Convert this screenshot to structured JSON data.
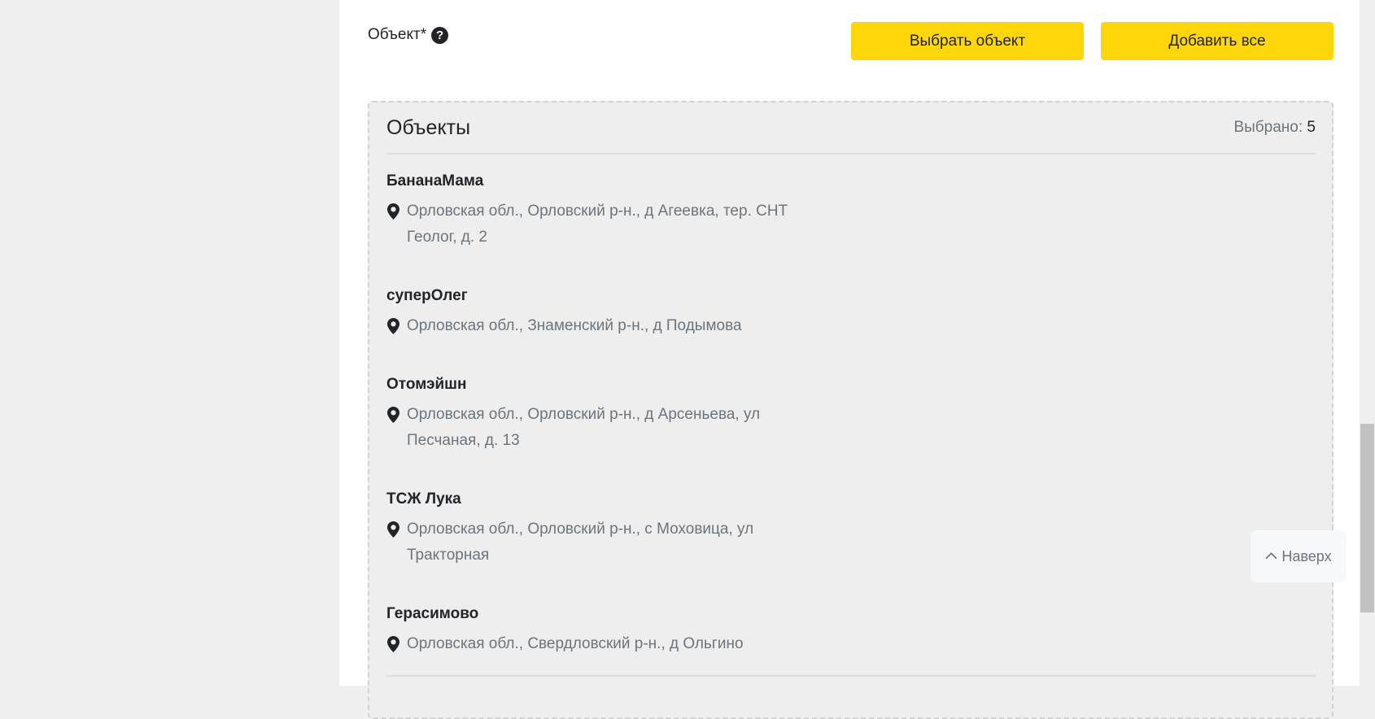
{
  "form": {
    "field_label": "Объект*",
    "help_icon_glyph": "?",
    "select_button": "Выбрать объект",
    "add_all_button": "Добавить все"
  },
  "objects_panel": {
    "title": "Объекты",
    "selected_label": "Выбрано:",
    "selected_count": "5",
    "items": [
      {
        "name": "БананаМама",
        "address": "Орловская обл., Орловский р-н., д Агеевка, тер. СНТ Геолог, д. 2"
      },
      {
        "name": "суперОлег",
        "address": "Орловская обл., Знаменский р-н., д Подымова"
      },
      {
        "name": "Отомэйшн",
        "address": "Орловская обл., Орловский р-н., д Арсеньева, ул Песчаная, д. 13"
      },
      {
        "name": "ТСЖ Лука",
        "address": "Орловская обл., Орловский р-н., с Моховица, ул Тракторная"
      },
      {
        "name": "Герасимово",
        "address": "Орловская обл., Свердловский р-н., д Ольгино"
      }
    ]
  },
  "scroll_top": {
    "label": "Наверх",
    "icon": "chevron-up-icon"
  },
  "colors": {
    "accent_yellow": "#ffd60a",
    "text_dark": "#212529",
    "text_muted": "#6c757d",
    "panel_bg": "#eeeeee"
  }
}
